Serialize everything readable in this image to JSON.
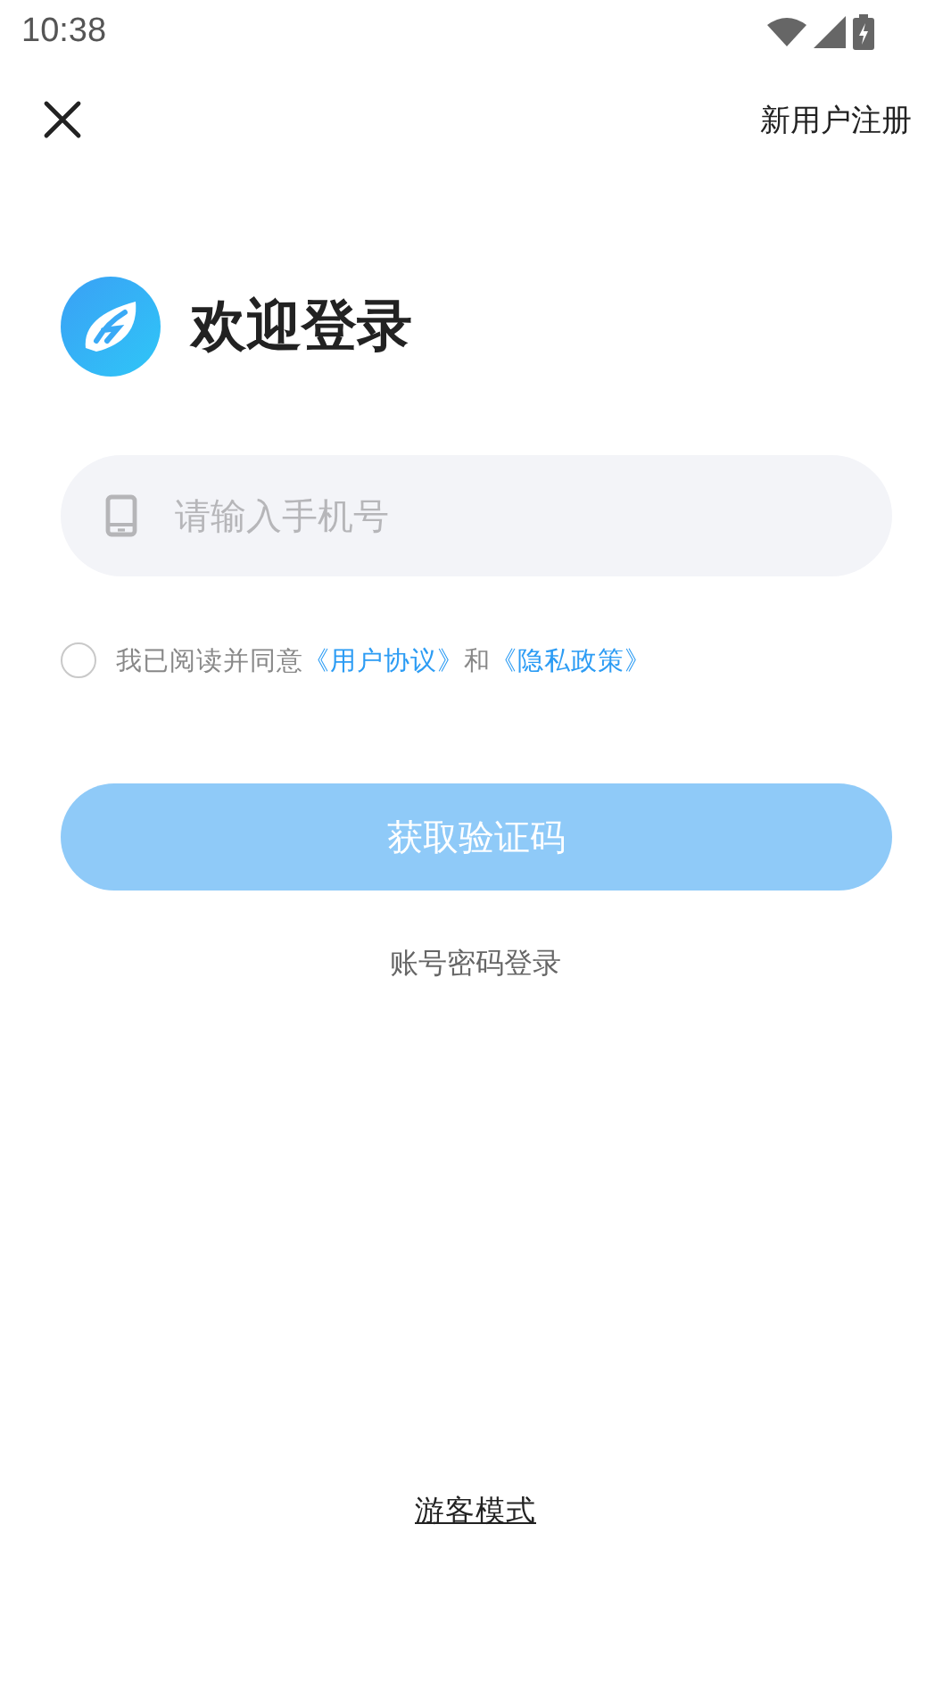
{
  "status_bar": {
    "time": "10:38"
  },
  "top_bar": {
    "register_link": "新用户注册"
  },
  "header": {
    "title": "欢迎登录"
  },
  "phone_field": {
    "placeholder": "请输入手机号"
  },
  "agreement": {
    "checked": false,
    "segments": [
      {
        "kind": "text",
        "text": "我已阅读并同意"
      },
      {
        "kind": "link",
        "text": "《用户协议》"
      },
      {
        "kind": "text",
        "text": "和"
      },
      {
        "kind": "link",
        "text": "《隐私政策》"
      }
    ]
  },
  "submit_button": {
    "label": "获取验证码",
    "disabled": true
  },
  "password_login_link": "账号密码登录",
  "guest_mode_link": "游客模式"
}
